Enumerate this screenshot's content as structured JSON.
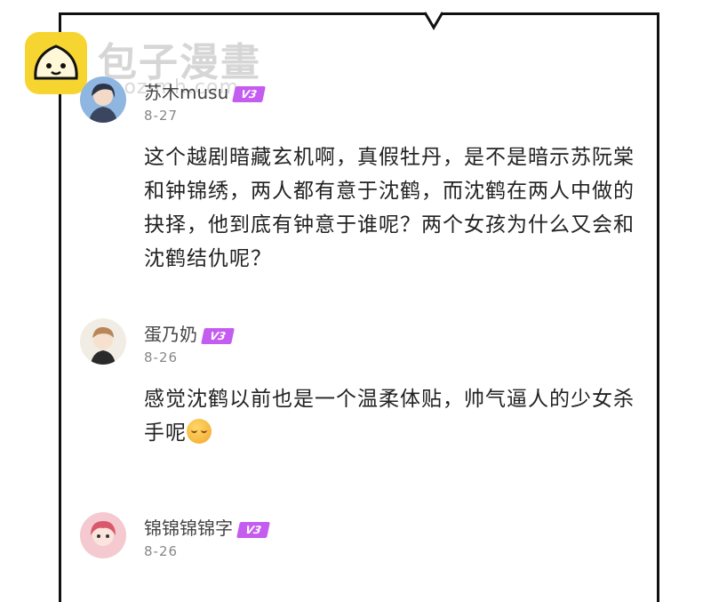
{
  "watermark": {
    "title": "包子漫畫",
    "url": "baozimh.com"
  },
  "comments": [
    {
      "username": "苏木musu",
      "level": "V3",
      "date": "8-27",
      "text": "这个越剧暗藏玄机啊，真假牡丹，是不是暗示苏阮棠和钟锦绣，两人都有意于沈鹤，而沈鹤在两人中做的抉择，他到底有钟意于谁呢？两个女孩为什么又会和沈鹤结仇呢？"
    },
    {
      "username": "蛋乃奶",
      "level": "V3",
      "date": "8-26",
      "text": "感觉沈鹤以前也是一个温柔体贴，帅气逼人的少女杀手呢"
    },
    {
      "username": "锦锦锦锦字",
      "level": "V3",
      "date": "8-26",
      "text": ""
    }
  ],
  "colors": {
    "level_badge": "#c45cf0",
    "watermark_logo": "#f7d531"
  }
}
